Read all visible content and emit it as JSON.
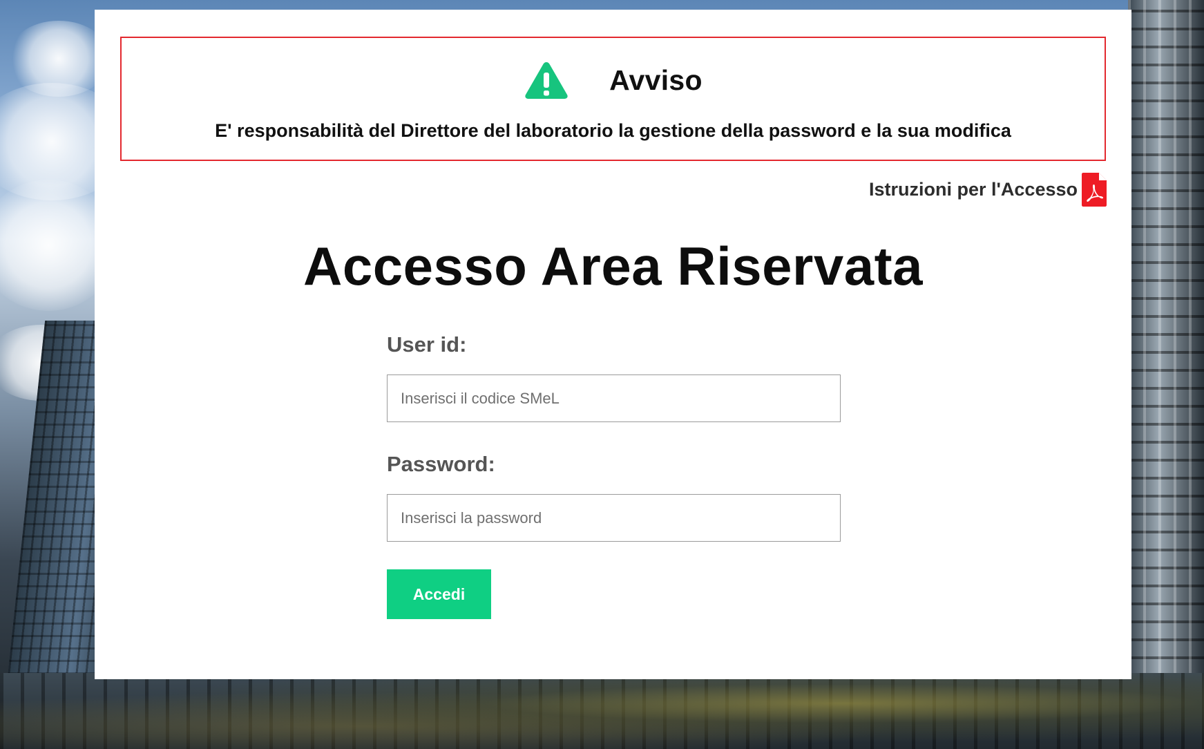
{
  "alert": {
    "icon": "warning-triangle-icon",
    "icon_color": "#17c47e",
    "border_color": "#e3282e",
    "title": "Avviso",
    "message": "E' responsabilità del Direttore del laboratorio la gestione della password e la sua modifica"
  },
  "instructions": {
    "label": "Istruzioni per l'Accesso",
    "icon": "pdf-icon",
    "icon_color": "#ee1c25"
  },
  "page": {
    "title": "Accesso Area Riservata"
  },
  "form": {
    "user": {
      "label": "User id:",
      "value": "",
      "placeholder": "Inserisci il codice SMeL"
    },
    "password": {
      "label": "Password:",
      "value": "",
      "placeholder": "Inserisci la password"
    },
    "submit": {
      "label": "Accedi",
      "color": "#0fcf83"
    }
  }
}
